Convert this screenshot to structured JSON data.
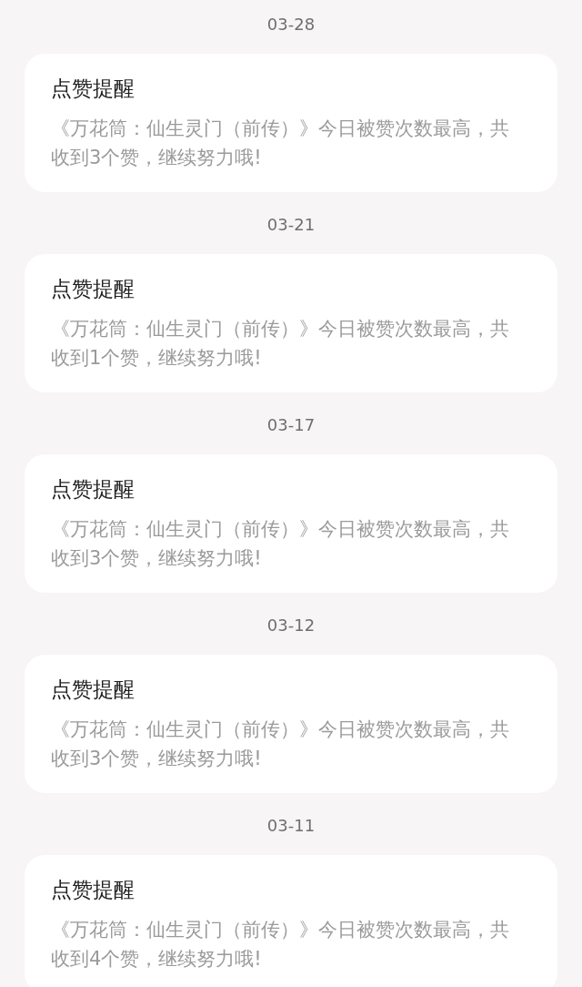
{
  "notifications": [
    {
      "date": "03-28",
      "title": "点赞提醒",
      "body": "《万花筒：仙生灵门（前传）》今日被赞次数最高，共收到3个赞，继续努力哦!"
    },
    {
      "date": "03-21",
      "title": "点赞提醒",
      "body": "《万花筒：仙生灵门（前传）》今日被赞次数最高，共收到1个赞，继续努力哦!"
    },
    {
      "date": "03-17",
      "title": "点赞提醒",
      "body": "《万花筒：仙生灵门（前传）》今日被赞次数最高，共收到3个赞，继续努力哦!"
    },
    {
      "date": "03-12",
      "title": "点赞提醒",
      "body": "《万花筒：仙生灵门（前传）》今日被赞次数最高，共收到3个赞，继续努力哦!"
    },
    {
      "date": "03-11",
      "title": "点赞提醒",
      "body": "《万花筒：仙生灵门（前传）》今日被赞次数最高，共收到4个赞，继续努力哦!"
    }
  ]
}
